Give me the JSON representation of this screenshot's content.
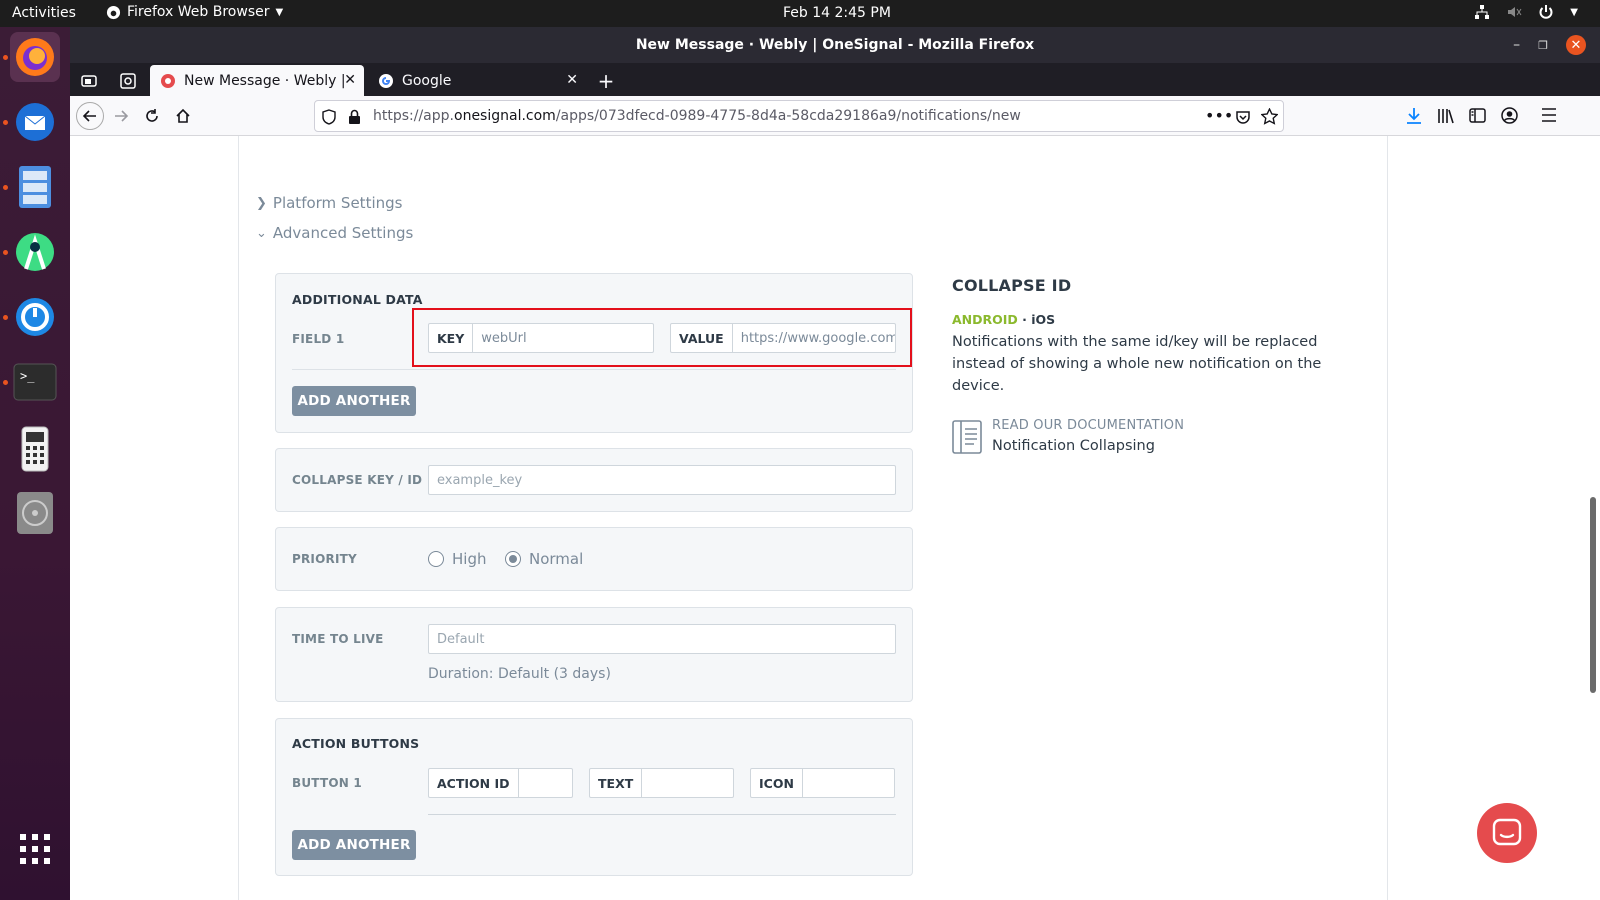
{
  "topbar": {
    "activities": "Activities",
    "app_menu": "Firefox Web Browser",
    "clock": "Feb 14  2:45 PM"
  },
  "window": {
    "title": "New Message · Webly | OneSignal - Mozilla Firefox"
  },
  "tabs": [
    {
      "label": "New Message · Webly | O",
      "active": true
    },
    {
      "label": "Google",
      "active": false
    }
  ],
  "urlbar": {
    "url_prefix": "https://app.",
    "url_domain": "onesignal.com",
    "url_path": "/apps/073dfecd-0989-4775-8d4a-58cda29186a9/notifications/new"
  },
  "sections": {
    "platform_settings": "Platform Settings",
    "advanced_settings": "Advanced Settings"
  },
  "additional_data": {
    "title": "ADDITIONAL DATA",
    "field_label": "FIELD 1",
    "key_label": "KEY",
    "key_value": "webUrl",
    "value_label": "VALUE",
    "value_value": "https://www.google.com/",
    "add_another": "ADD ANOTHER"
  },
  "collapse": {
    "label": "COLLAPSE KEY / ID",
    "placeholder": "example_key"
  },
  "priority": {
    "label": "PRIORITY",
    "options": [
      "High",
      "Normal"
    ],
    "selected": "Normal"
  },
  "ttl": {
    "label": "TIME TO LIVE",
    "placeholder": "Default",
    "duration": "Duration: Default (3 days)"
  },
  "action_buttons": {
    "title": "ACTION BUTTONS",
    "button_label": "BUTTON 1",
    "action_id_label": "ACTION ID",
    "text_label": "TEXT",
    "icon_label": "ICON",
    "add_another": "ADD ANOTHER"
  },
  "help": {
    "title": "COLLAPSE ID",
    "platform_android": "ANDROID",
    "platform_sep": " · ",
    "platform_ios": "iOS",
    "text": "Notifications with the same id/key will be replaced instead of showing a whole new notification on the device.",
    "doc_link": "READ OUR DOCUMENTATION",
    "doc_name": "Notification Collapsing"
  },
  "colors": {
    "android": "#8bb92d",
    "highlight": "#e3101b",
    "button_gray": "#7d8fa1",
    "chat": "#e54b4d"
  }
}
